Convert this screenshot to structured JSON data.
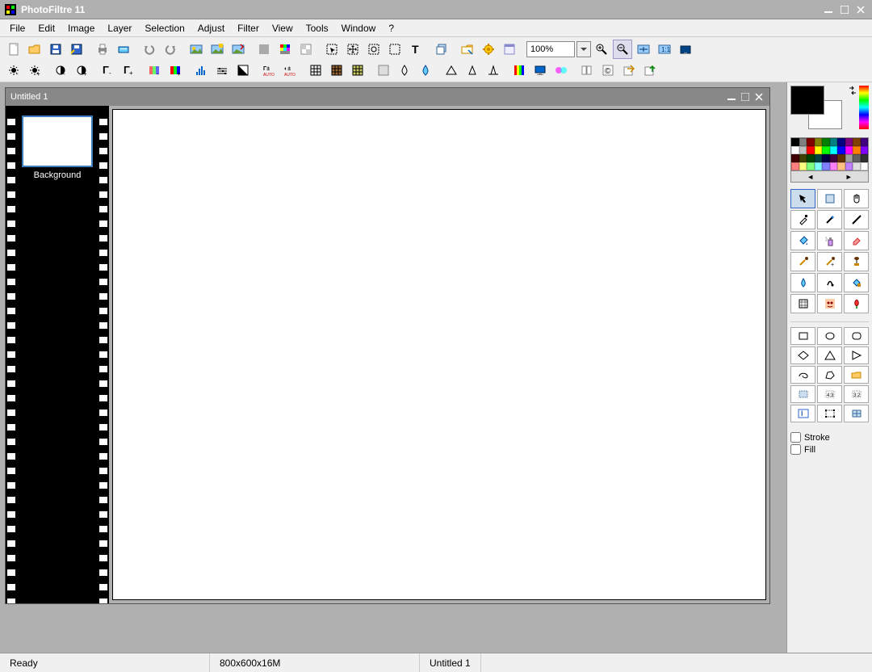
{
  "app_title": "PhotoFiltre 11",
  "menu": [
    "File",
    "Edit",
    "Image",
    "Layer",
    "Selection",
    "Adjust",
    "Filter",
    "View",
    "Tools",
    "Window",
    "?"
  ],
  "zoom": "100%",
  "document": {
    "title": "Untitled 1",
    "layer_name": "Background"
  },
  "status": {
    "ready": "Ready",
    "size": "800x600x16M",
    "doc": "Untitled 1"
  },
  "side": {
    "stroke": "Stroke",
    "fill": "Fill"
  },
  "palette_colors": [
    "#000000",
    "#808080",
    "#800000",
    "#808000",
    "#008000",
    "#008080",
    "#000080",
    "#800080",
    "#804000",
    "#400080",
    "#ffffff",
    "#c0c0c0",
    "#ff0000",
    "#ffff00",
    "#00ff00",
    "#00ffff",
    "#0000ff",
    "#ff00ff",
    "#ff8000",
    "#8000ff",
    "#400000",
    "#404000",
    "#004000",
    "#004040",
    "#000040",
    "#400040",
    "#603000",
    "#a0a0a0",
    "#606060",
    "#303030",
    "#ff8080",
    "#ffff80",
    "#80ff80",
    "#80ffff",
    "#8080ff",
    "#ff80ff",
    "#ffc080",
    "#c080ff",
    "#e0e0e0",
    "#ffffff"
  ]
}
